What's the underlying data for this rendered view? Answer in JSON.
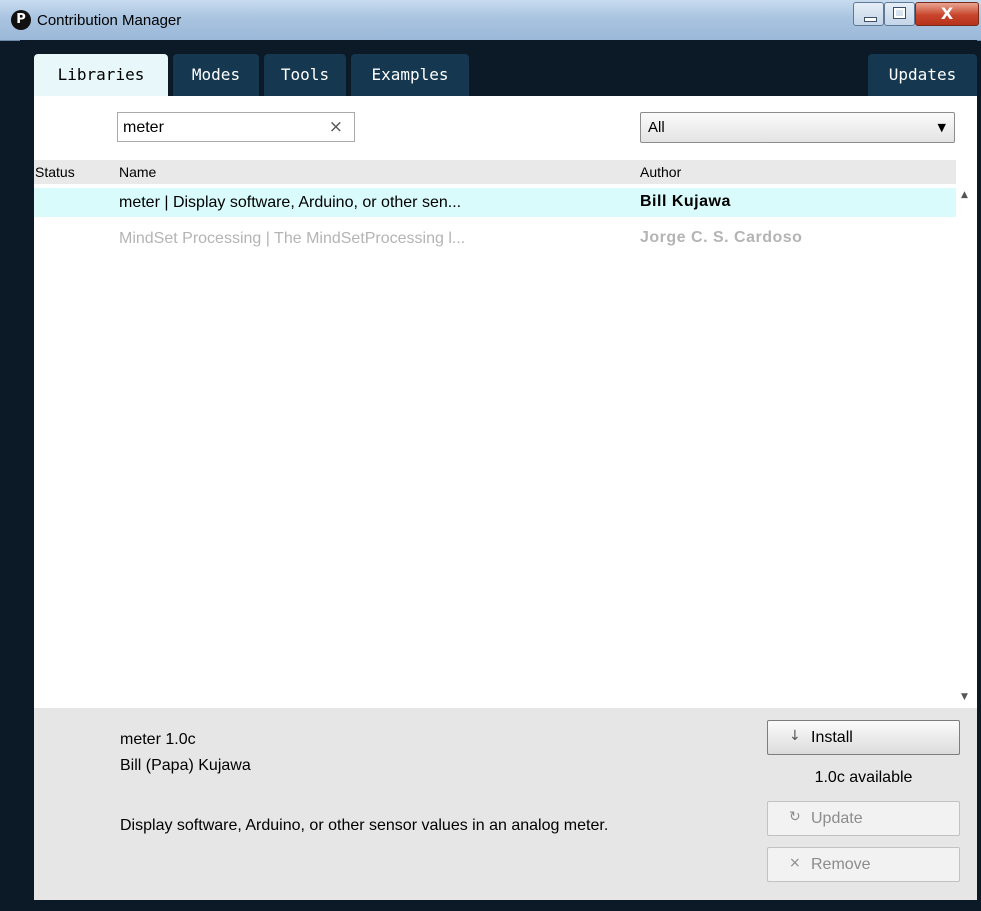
{
  "window": {
    "title": "Contribution Manager",
    "app_icon_glyph": "P",
    "controls": {
      "minimize": "minimize-icon",
      "maximize": "maximize-icon",
      "close": "X"
    }
  },
  "tabs": [
    {
      "label": "Libraries",
      "active": true
    },
    {
      "label": "Modes",
      "active": false
    },
    {
      "label": "Tools",
      "active": false
    },
    {
      "label": "Examples",
      "active": false
    }
  ],
  "updates_tab": {
    "label": "Updates"
  },
  "search": {
    "value": "meter",
    "clear_icon": "×"
  },
  "filter": {
    "selected": "All",
    "arrow": "▼"
  },
  "table": {
    "headers": {
      "status": "Status",
      "name": "Name",
      "author": "Author"
    },
    "rows": [
      {
        "name": "meter | Display software, Arduino, or other sen...",
        "author": "Bill  Kujawa",
        "selected": true,
        "installed": false
      },
      {
        "name": "MindSet Processing | The MindSetProcessing l...",
        "author": "Jorge C. S. Cardoso",
        "selected": false,
        "installed": false
      }
    ]
  },
  "scrollbar": {
    "up": "▲",
    "down": "▼"
  },
  "details": {
    "title": "meter 1.0c",
    "author": "Bill (Papa) Kujawa",
    "description": "Display software, Arduino, or other sensor values in an analog meter.",
    "available": "1.0c available",
    "install": {
      "icon": "↓",
      "label": "Install"
    },
    "update": {
      "icon": "↻",
      "label": "Update"
    },
    "remove": {
      "icon": "×",
      "label": "Remove"
    }
  },
  "colors": {
    "tab_active": "#e8f7f9",
    "tab_inactive": "#15374f",
    "frame": "#0b1a26",
    "selected_row": "#d9fbfb",
    "details_bg": "#e6e6e6",
    "dim_text": "#b4b4b4"
  }
}
